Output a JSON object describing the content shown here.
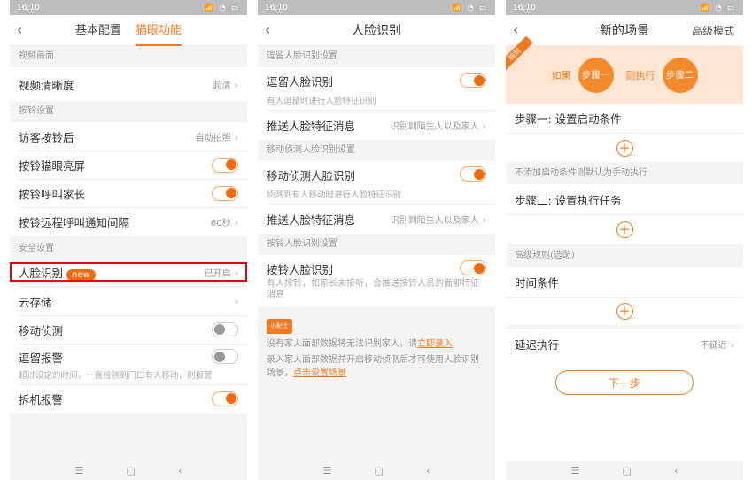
{
  "status": {
    "time": "16:10",
    "icons": "📶 ◔ ▭"
  },
  "nav": {
    "menu": "☰",
    "home": "▢",
    "back": "‹"
  },
  "p1": {
    "tabs": [
      "基本配置",
      "猫眼功能"
    ],
    "sec_video": "视频画面",
    "video_quality": "视频清晰度",
    "video_quality_val": "超清",
    "sec_bell": "按铃设置",
    "visitor": "访客按铃后",
    "visitor_val": "自动拍照",
    "bell_screen": "按铃猫眼亮屏",
    "bell_call": "按铃呼叫家长",
    "bell_interval": "按铃远程呼叫通知间隔",
    "bell_interval_val": "60秒",
    "sec_security": "安全设置",
    "face": "人脸识别",
    "face_badge": "new",
    "face_val": "已开启",
    "cloud": "云存储",
    "motion": "移动侦测",
    "linger": "逗留报警",
    "linger_desc": "超过设定的时间，一直检测到门口有人移动，则报警",
    "tamper": "拆机报警"
  },
  "p2": {
    "title": "人脸识别",
    "sec1": "逗留人脸识别设置",
    "linger_face": "逗留人脸识别",
    "linger_desc": "有人逗留时进行人脸特征识别",
    "push1": "推送人脸特征消息",
    "push_val": "识别到陌生人以及家人",
    "sec2": "移动侦测人脸识别设置",
    "motion_face": "移动侦测人脸识别",
    "motion_desc": "侦测到有人移动时进行人脸特征识别",
    "push2": "推送人脸特征消息",
    "sec3": "按铃人脸识别设置",
    "bell_face": "按铃人脸识别",
    "bell_desc": "有人按铃，如家长未接听，会推送按铃人员的面部特征消息",
    "tip_badge": "小贴士",
    "tip1": "没有家人面部数据将无法识别家人，请",
    "tip1_link": "立即录入",
    "tip2": "录入家人面部数据并开启移动侦测后才可使用人脸识别场景，",
    "tip2_link": "点击设置场景"
  },
  "p3": {
    "title": "新的场景",
    "advanced": "高级模式",
    "corner": "规则",
    "if": "如果",
    "step1": "步骤一",
    "then": "则执行",
    "step2": "步骤二",
    "step1_title": "步骤一: 设置启动条件",
    "note": "不添加启动条件则默认为手动执行",
    "step2_title": "步骤二: 设置执行任务",
    "adv_rules": "高级规则(选配)",
    "time_cond": "时间条件",
    "delay": "延迟执行",
    "delay_val": "不延迟",
    "next": "下一步",
    "plus": "+"
  },
  "colors": {
    "accent": "#f07a22",
    "highlight": "#e60012"
  }
}
